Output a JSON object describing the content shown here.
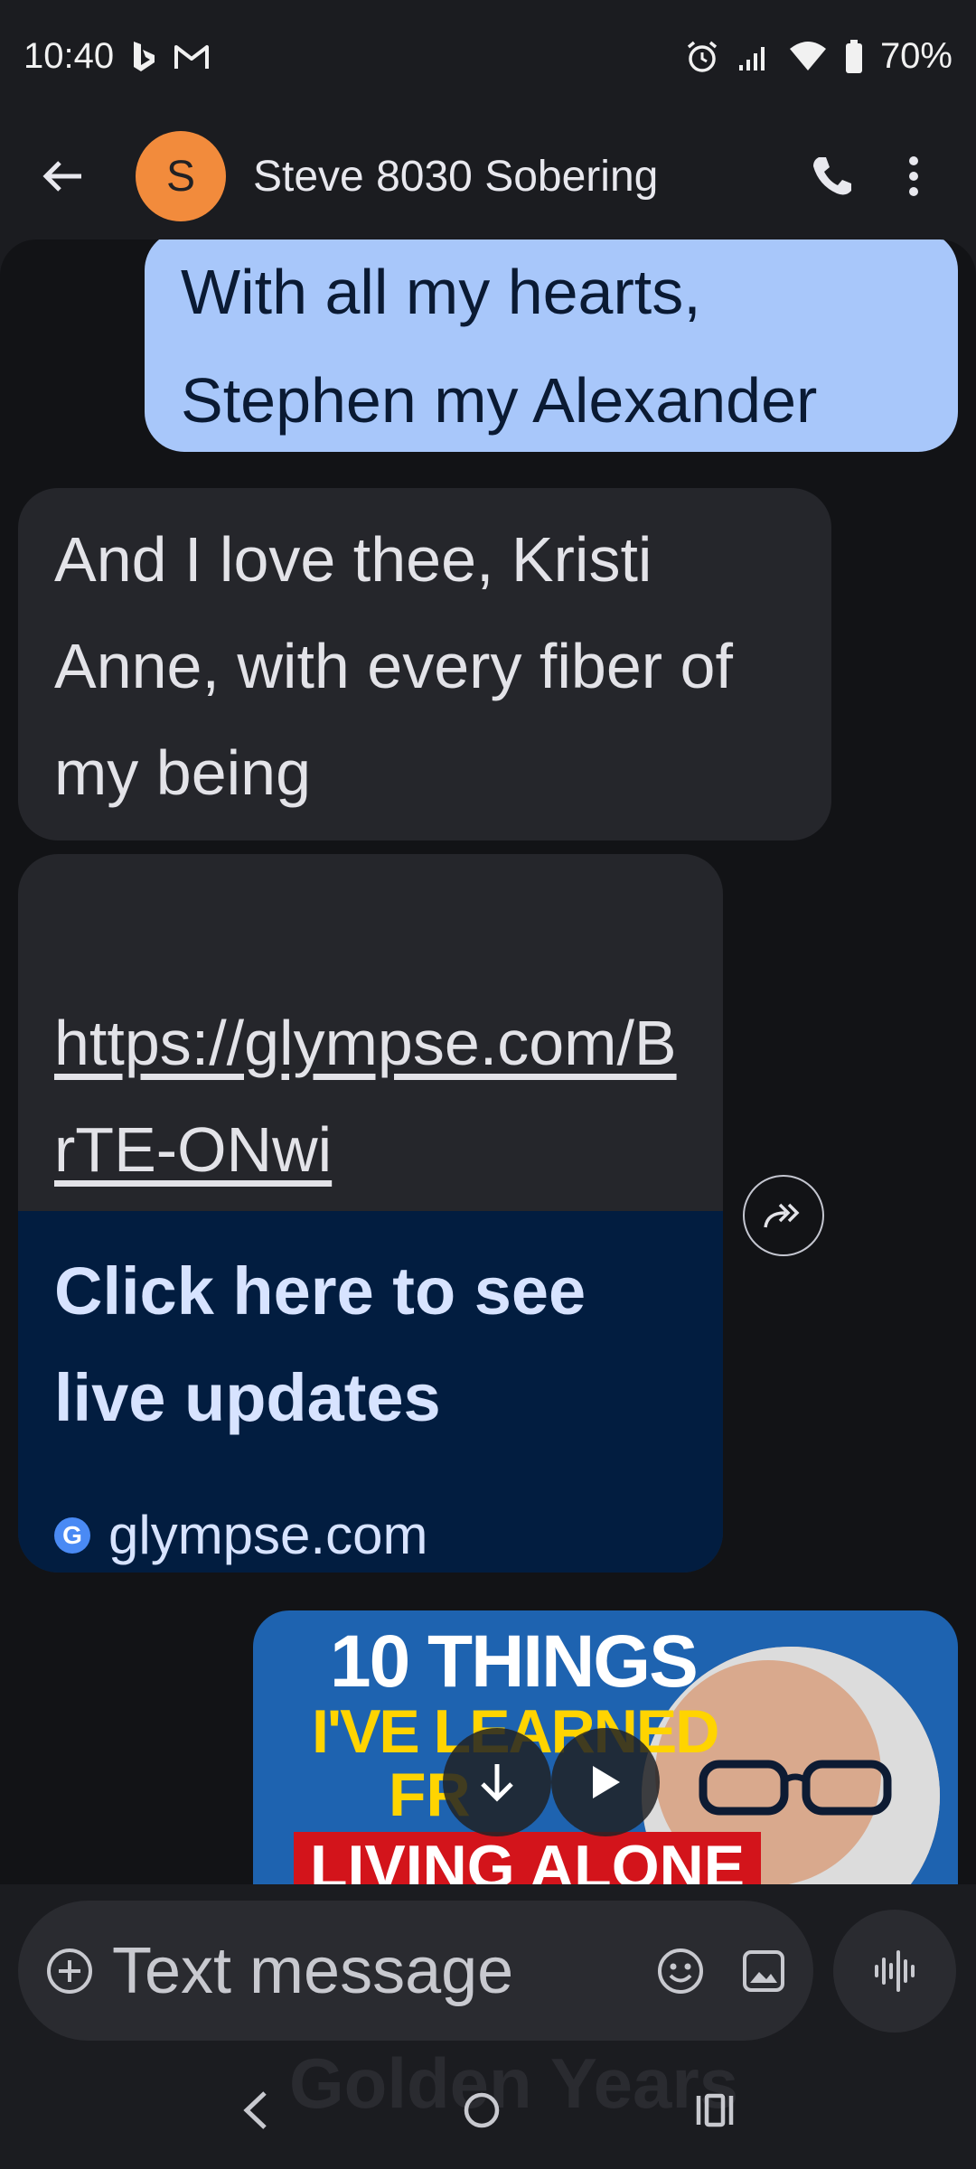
{
  "status_bar": {
    "time": "10:40",
    "battery": "70%",
    "left_icons": [
      "bing-icon",
      "gmail-icon"
    ],
    "right_icons": [
      "alarm-icon",
      "signal-icon",
      "wifi-icon",
      "battery-icon"
    ]
  },
  "header": {
    "avatar_letter": "S",
    "contact_name": "Steve 8030 Sobering"
  },
  "messages": [
    {
      "direction": "outgoing",
      "text_line1": "With all my hearts,",
      "text_line2": "Stephen my Alexander"
    },
    {
      "direction": "incoming",
      "text": "And I love thee, Kristi Anne, with every fiber of my being"
    },
    {
      "direction": "incoming",
      "link": "https://glympse.com/BrTE-ONwi",
      "preview_title": "Click here to see live updates",
      "preview_site": "glympse.com",
      "preview_icon_letter": "G"
    },
    {
      "direction": "outgoing",
      "video_line1": "10 THINGS",
      "video_line2": "I'VE LEARNED",
      "video_line3": "FR",
      "video_line4": "LIVING ALONE"
    }
  ],
  "compose": {
    "placeholder": "Text message"
  },
  "ghost_text": "Golden Years",
  "colors": {
    "outgoing_bubble": "#a8c7fa",
    "incoming_bubble": "#25262b",
    "avatar": "#f28b3c",
    "preview_bg": "#021d40"
  }
}
